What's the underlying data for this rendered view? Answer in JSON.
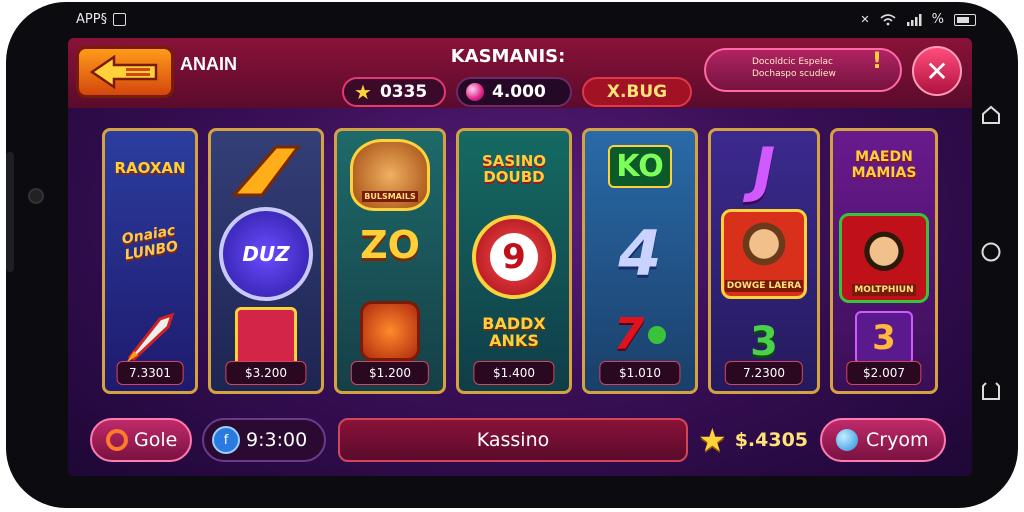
{
  "status_bar": {
    "left_text": "APP§"
  },
  "header": {
    "left_title": "ANAIN",
    "center_title": "KASMANIS:",
    "coins": "0335",
    "gems": "4.000",
    "bonus": "X.BUG",
    "notice_line1": "Docoldcic Espelac",
    "notice_line2": "Dochaspo scudiew"
  },
  "reels": [
    {
      "top": "RAOXAN",
      "mid": "Onaiac LUNBO",
      "footer": "7.3301"
    },
    {
      "top": "Z",
      "mid": "DUZ",
      "footer": "$3.200"
    },
    {
      "top": "BULSMAILS",
      "mid": "ZO",
      "footer": "$1.200"
    },
    {
      "top": "SASINO DOUBD",
      "mid": "9",
      "bottom": "BADDX ANKS",
      "footer": "$1.400"
    },
    {
      "top": "KO",
      "mid": "4",
      "footer": "$1.010"
    },
    {
      "top": "J",
      "mid": "DOWGE LAERA",
      "bottom": "3",
      "footer": "7.2300"
    },
    {
      "top": "MAEDN MAMIAS",
      "mid": "MOLTPHIUN",
      "bottom": "3",
      "footer": "$2.007"
    }
  ],
  "footer": {
    "left_button": "Gole",
    "balance": "9:3:00",
    "center_label": "Kassino",
    "win": "$.4305",
    "right_button": "Cryom"
  },
  "colors": {
    "accent": "#e43a73",
    "gold": "#d5a241",
    "purple": "#3a0f57"
  }
}
